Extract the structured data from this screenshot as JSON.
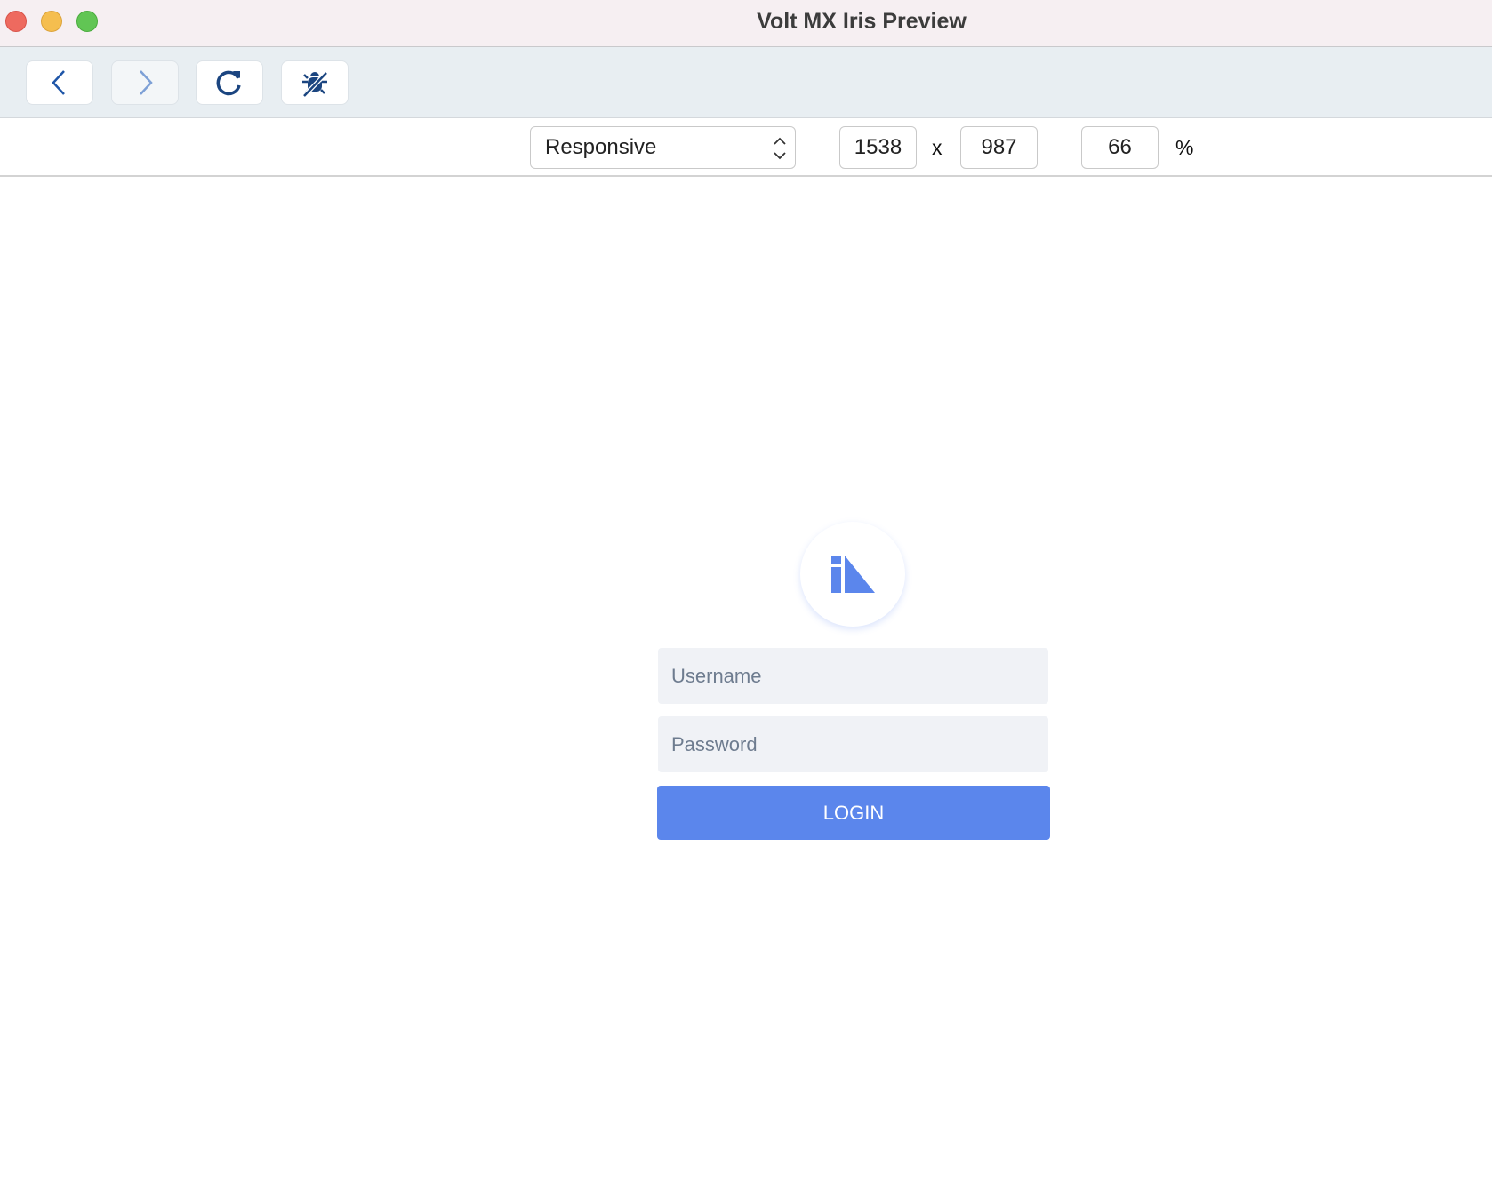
{
  "window": {
    "title": "Volt MX Iris Preview"
  },
  "toolbar": {
    "back": "back",
    "forward": "forward",
    "reload": "reload",
    "debug": "debug-off"
  },
  "controls": {
    "device": "Responsive",
    "width": "1538",
    "separator": "x",
    "height": "987",
    "zoom": "66",
    "zoom_unit": "%"
  },
  "login": {
    "username_placeholder": "Username",
    "password_placeholder": "Password",
    "button": "LOGIN"
  },
  "colors": {
    "accent": "#5b86ec",
    "icon": "#1b4580"
  }
}
